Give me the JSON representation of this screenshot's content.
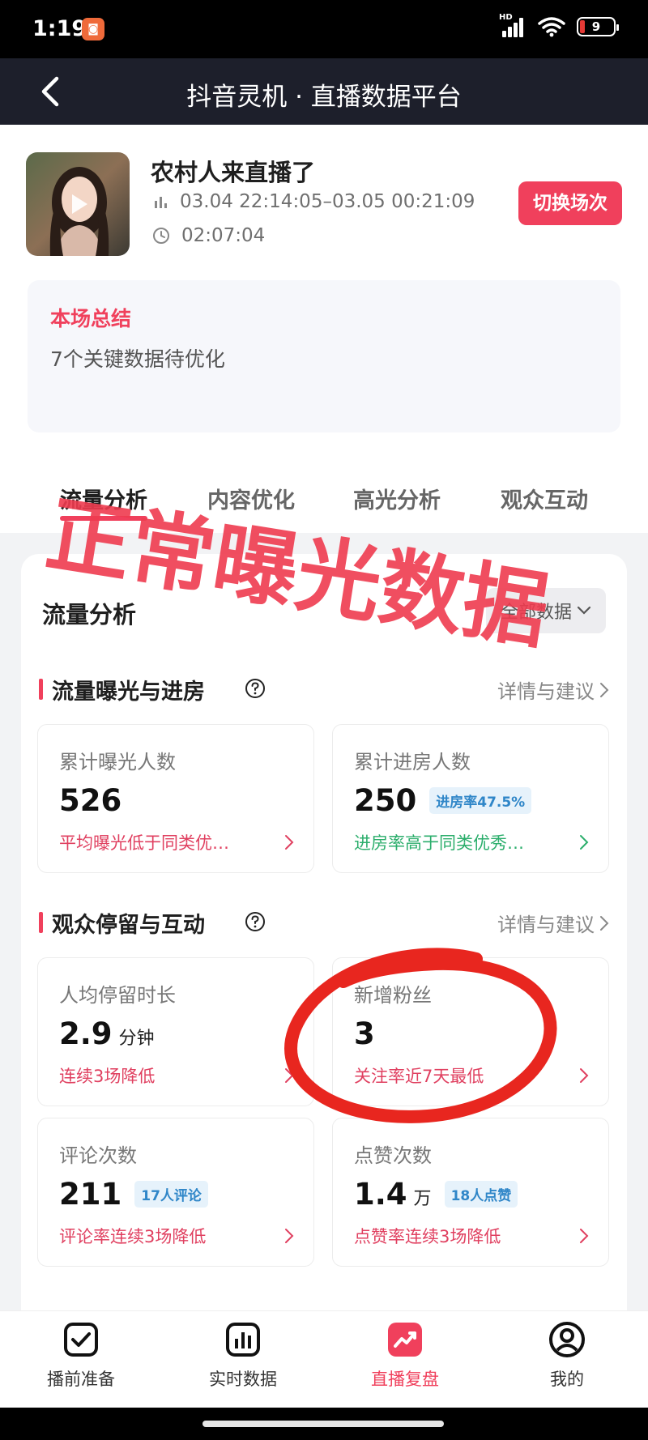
{
  "status_bar": {
    "time": "1:19",
    "battery": "9",
    "network_label": "HD"
  },
  "nav": {
    "title": "抖音灵机 · 直播数据平台"
  },
  "stream": {
    "name": "农村人来直播了",
    "time_range": "03.04 22:14:05–03.05 00:21:09",
    "duration": "02:07:04",
    "switch_label": "切换场次"
  },
  "summary": {
    "title": "本场总结",
    "text": "7个关键数据待优化"
  },
  "tabs": [
    {
      "label": "流量分析",
      "active": true
    },
    {
      "label": "内容优化",
      "active": false
    },
    {
      "label": "高光分析",
      "active": false
    },
    {
      "label": "观众互动",
      "active": false
    }
  ],
  "overlay": {
    "stamp_text": "正常曝光数据",
    "highlight_color": "#e8261f"
  },
  "traffic": {
    "title": "流量分析",
    "select_label": "全部数据",
    "section1": {
      "title": "流量曝光与进房",
      "link": "详情与建议",
      "metrics": [
        {
          "label": "累计曝光人数",
          "value": "526",
          "tag": "",
          "note": "平均曝光低于同类优…"
        },
        {
          "label": "累计进房人数",
          "value": "250",
          "tag": "进房率47.5%",
          "note": "进房率高于同类优秀…"
        }
      ]
    },
    "section2": {
      "title": "观众停留与互动",
      "link": "详情与建议",
      "metrics": [
        {
          "label": "人均停留时长",
          "value": "2.9",
          "unit": "分钟",
          "note": "连续3场降低"
        },
        {
          "label": "新增粉丝",
          "value": "3",
          "note": "关注率近7天最低"
        },
        {
          "label": "评论次数",
          "value": "211",
          "tag": "17人评论",
          "note": "评论率连续3场降低"
        },
        {
          "label": "点赞次数",
          "value": "1.4",
          "unit": "万",
          "tag": "18人点赞",
          "note": "点赞率连续3场降低"
        }
      ]
    }
  },
  "bottom_nav": [
    {
      "label": "播前准备",
      "icon": "checkbox-icon",
      "active": false
    },
    {
      "label": "实时数据",
      "icon": "bar-chart-icon",
      "active": false
    },
    {
      "label": "直播复盘",
      "icon": "trend-icon",
      "active": true
    },
    {
      "label": "我的",
      "icon": "user-icon",
      "active": false
    }
  ],
  "colors": {
    "accent": "#f0405c",
    "nav_bg": "#1d1f2b",
    "tag_blue": "#2f86c8",
    "good_green": "#2cae6c"
  }
}
